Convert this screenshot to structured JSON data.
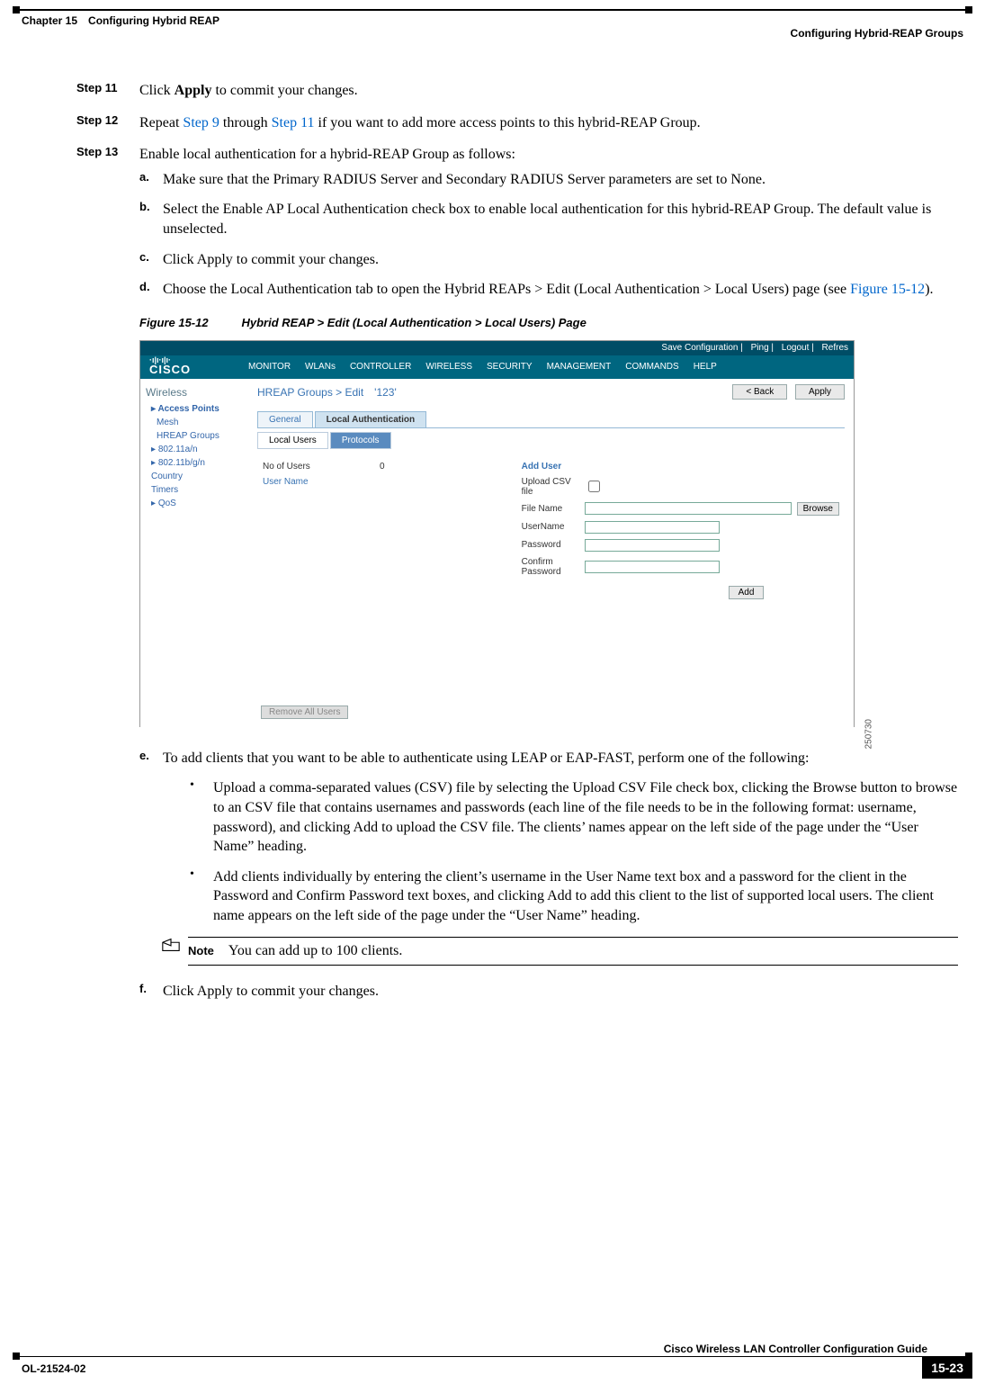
{
  "header": {
    "left": "Chapter 15 Configuring Hybrid REAP",
    "right": "Configuring Hybrid-REAP Groups"
  },
  "steps": {
    "s11": {
      "label": "Step 11",
      "pre": "Click ",
      "bold": "Apply",
      "post": " to commit your changes."
    },
    "s12": {
      "label": "Step 12",
      "t1": "Repeat ",
      "l1": "Step 9",
      "t2": " through ",
      "l2": "Step 11",
      "t3": " if you want to add more access points to this hybrid-REAP Group."
    },
    "s13": {
      "label": "Step 13",
      "text": "Enable local authentication for a hybrid-REAP Group as follows:"
    }
  },
  "subs": {
    "a": {
      "label": "a.",
      "t1": "Make sure that the Primary RADIUS Server and Secondary RADIUS Server parameters are set to ",
      "b1": "None",
      "t2": "."
    },
    "b": {
      "label": "b.",
      "t1": "Select the ",
      "b1": "Enable AP Local Authentication",
      "t2": " check box to enable local authentication for this hybrid-REAP Group. The default value is unselected."
    },
    "c": {
      "label": "c.",
      "t1": "Click ",
      "b1": "Apply",
      "t2": " to commit your changes."
    },
    "d": {
      "label": "d.",
      "t1": "Choose the ",
      "b1": "Local Authentication",
      "t2": " tab to open the Hybrid REAPs > Edit (Local Authentication > Local Users) page (see ",
      "l1": "Figure 15-12",
      "t3": ")."
    },
    "e": {
      "label": "e.",
      "text": "To add clients that you want to be able to authenticate using LEAP or EAP-FAST, perform one of the following:"
    },
    "f": {
      "label": "f.",
      "t1": "Click ",
      "b1": "Apply",
      "t2": " to commit your changes."
    }
  },
  "figure": {
    "label": "Figure 15-12",
    "title": "Hybrid REAP > Edit (Local Authentication > Local Users) Page"
  },
  "shot": {
    "toplinks": {
      "save": "Save Configuration",
      "ping": "Ping",
      "logout": "Logout",
      "refresh": "Refres"
    },
    "logo": "CISCO",
    "nav": [
      "MONITOR",
      "WLANs",
      "CONTROLLER",
      "WIRELESS",
      "SECURITY",
      "MANAGEMENT",
      "COMMANDS",
      "HELP"
    ],
    "side_title": "Wireless",
    "side": {
      "ap": "Access Points",
      "mesh": "Mesh",
      "hreap": "HREAP Groups",
      "b1": "802.11a/n",
      "b2": "802.11b/g/n",
      "country": "Country",
      "timers": "Timers",
      "qos": "QoS"
    },
    "crumb": "HREAP Groups > Edit '123'",
    "btn_back": "< Back",
    "btn_apply": "Apply",
    "tab_general": "General",
    "tab_local": "Local Authentication",
    "subtab_users": "Local Users",
    "subtab_proto": "Protocols",
    "left_no": "No of Users",
    "left_no_val": "0",
    "left_un": "User Name",
    "right_title": "Add User",
    "r_upload": "Upload CSV file",
    "r_filename": "File Name",
    "r_browse": "Browse",
    "r_user": "UserName",
    "r_pass": "Password",
    "r_conf": "Confirm Password",
    "r_add": "Add",
    "remove": "Remove All Users",
    "imgid": "250730"
  },
  "bullets": {
    "b1_1": "Upload a comma-separated values (CSV) file by selecting the ",
    "b1_b1": "Upload CSV File",
    "b1_2": " check box, clicking the ",
    "b1_b2": "Browse",
    "b1_3": " button to browse to an CSV file that contains usernames and passwords (each line of the file needs to be in the following format: username, password), and clicking ",
    "b1_b3": "Add",
    "b1_4": " to upload the CSV file. The clients’ names appear on the left side of the page under the “User Name” heading.",
    "b2_1": "Add clients individually by entering the client’s username in the User Name text box and a password for the client in the Password and Confirm Password text boxes, and clicking ",
    "b2_b1": "Add",
    "b2_2": " to add this client to the list of supported local users. The client name appears on the left side of the page under the “User Name” heading."
  },
  "note": {
    "label": "Note",
    "text": "You can add up to 100 clients."
  },
  "footer": {
    "guide": "Cisco Wireless LAN Controller Configuration Guide",
    "doc": "OL-21524-02",
    "page": "15-23"
  }
}
